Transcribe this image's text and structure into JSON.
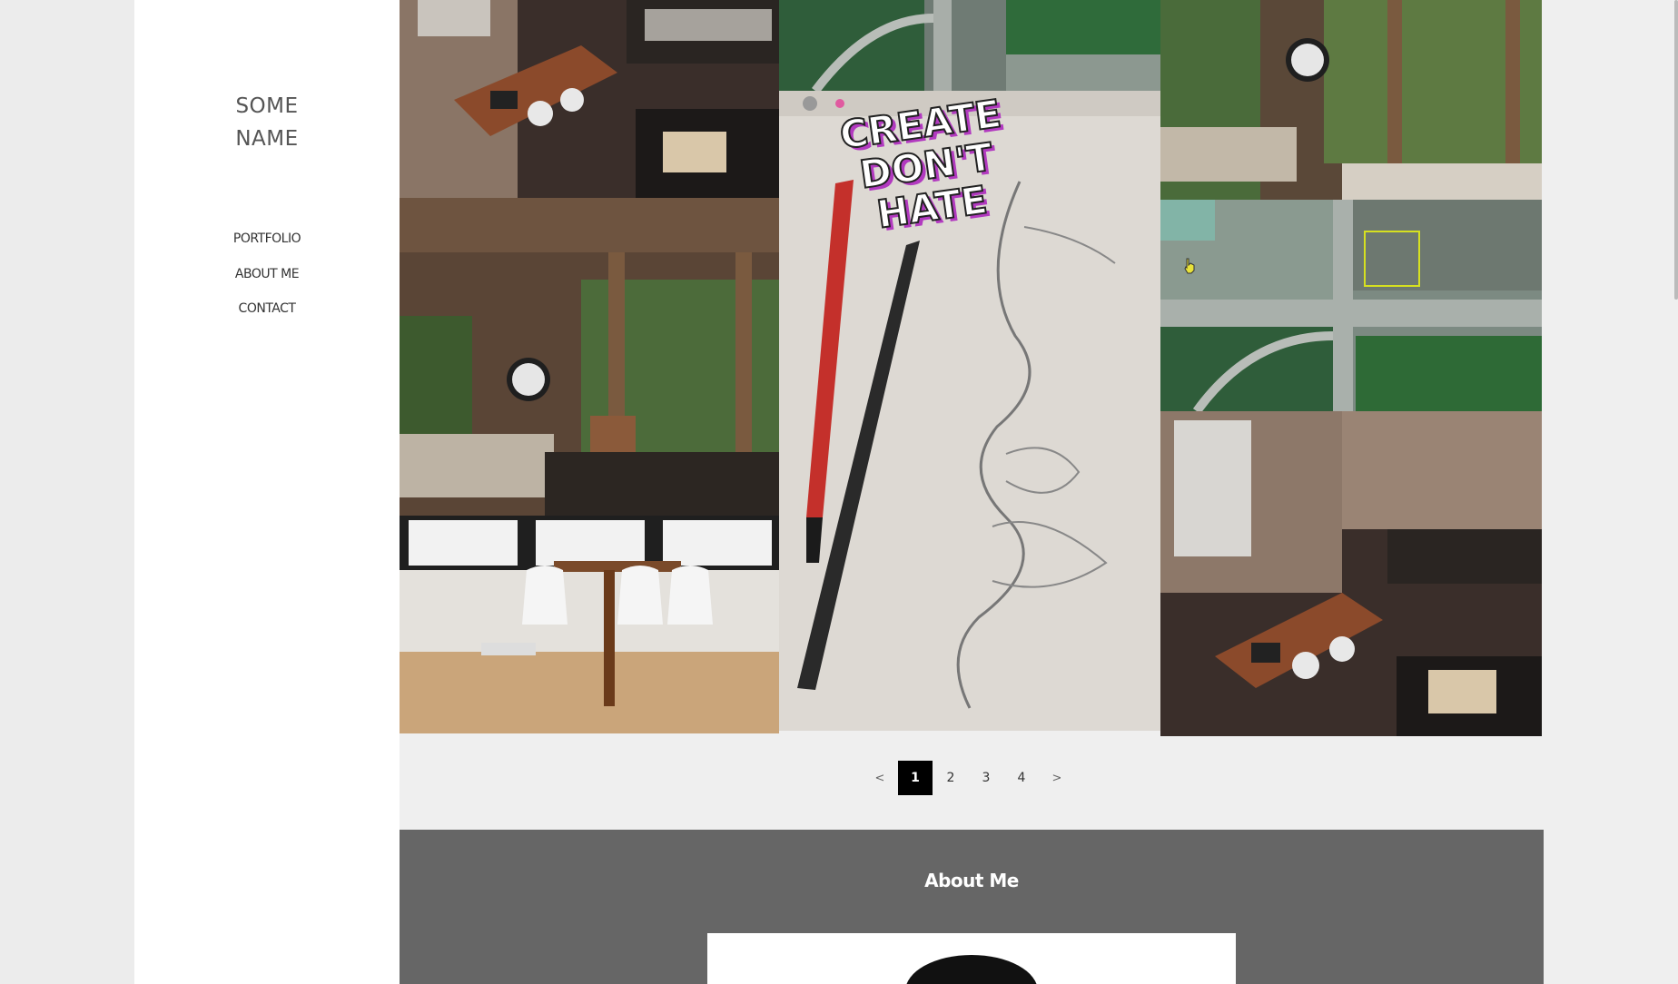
{
  "site": {
    "title_line1": "SOME",
    "title_line2": "NAME"
  },
  "nav": {
    "items": [
      {
        "label": "PORTFOLIO"
      },
      {
        "label": "ABOUT ME"
      },
      {
        "label": "CONTACT"
      }
    ]
  },
  "gallery": {
    "sticker_lines": [
      "CREATE",
      "DON'T",
      "HATE"
    ]
  },
  "pagination": {
    "prev": "<",
    "pages": [
      "1",
      "2",
      "3",
      "4"
    ],
    "next": ">",
    "current": "1"
  },
  "about": {
    "title": "About Me"
  },
  "colors": {
    "active_page_bg": "#000000",
    "about_bg": "#666666",
    "sidebar_bg": "#ffffff"
  }
}
